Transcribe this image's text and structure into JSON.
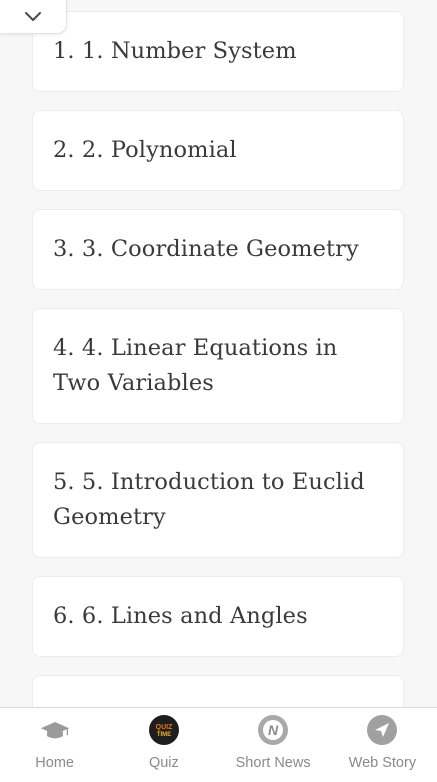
{
  "chapters": [
    {
      "title": "1. 1. Number System"
    },
    {
      "title": "2. 2. Polynomial"
    },
    {
      "title": "3. 3. Coordinate Geometry"
    },
    {
      "title": "4. 4. Linear Equations in Two Variables"
    },
    {
      "title": "5. 5. Introduction to Euclid Geometry"
    },
    {
      "title": "6. 6. Lines and Angles"
    }
  ],
  "bottom_nav": {
    "items": [
      {
        "label": "Home",
        "icon": "graduation-cap-icon"
      },
      {
        "label": "Quiz",
        "icon": "quiz-time-icon",
        "badge": "QUIZ TIME"
      },
      {
        "label": "Short News",
        "icon": "news-icon",
        "badge": "N"
      },
      {
        "label": "Web Story",
        "icon": "send-arrow-icon"
      }
    ]
  },
  "colors": {
    "background": "#f7f7f7",
    "card": "#ffffff",
    "title_text": "#3a3a3a",
    "nav_label": "#8a8a8a",
    "quiz_orange": "#e8731a",
    "icon_gray": "#9a9a9a"
  }
}
